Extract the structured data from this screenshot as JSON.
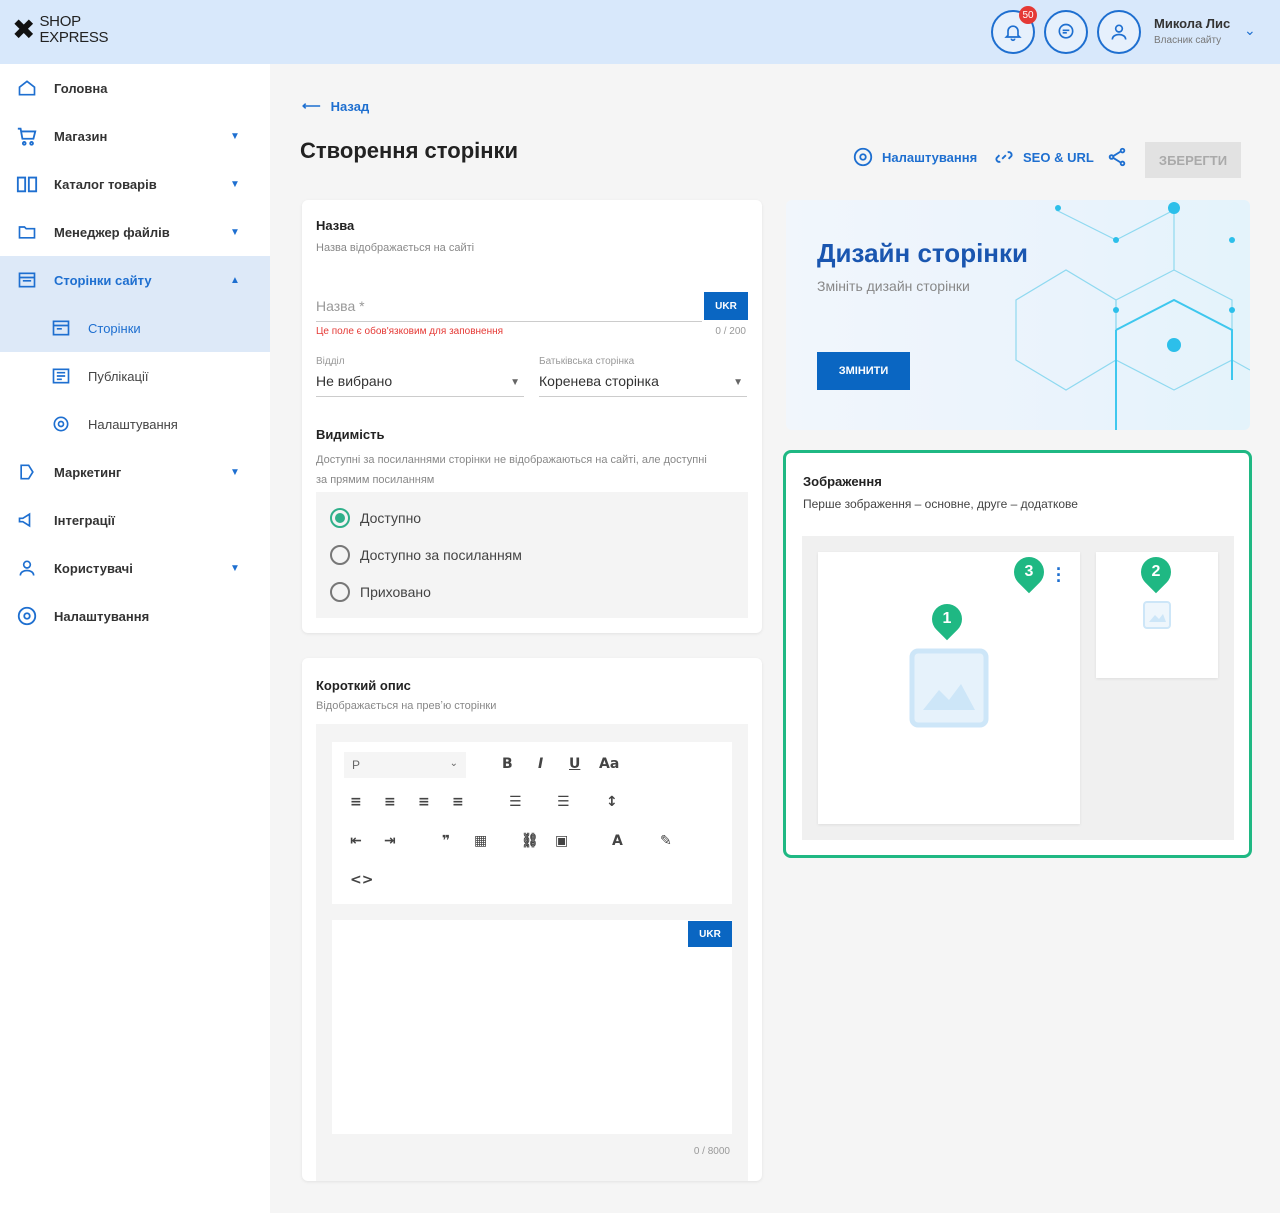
{
  "header": {
    "logo_top": "SHOP",
    "logo_bottom": "EXPRESS",
    "notifications_count": "50",
    "user_name": "Микола Лис",
    "user_role": "Власник сайту"
  },
  "sidebar": {
    "items": [
      {
        "label": "Головна"
      },
      {
        "label": "Магазин"
      },
      {
        "label": "Каталог товарів"
      },
      {
        "label": "Менеджер файлів"
      },
      {
        "label": "Сторінки сайту"
      },
      {
        "label": "Сторінки"
      },
      {
        "label": "Публікації"
      },
      {
        "label": "Налаштування"
      },
      {
        "label": "Маркетинг"
      },
      {
        "label": "Інтеграції"
      },
      {
        "label": "Користувачі"
      },
      {
        "label": "Налаштування"
      }
    ]
  },
  "page": {
    "back_label": "Назад",
    "title": "Створення сторінки",
    "settings_label": "Налаштування",
    "seo_label": "SEO & URL",
    "save_label": "ЗБЕРЕГТИ"
  },
  "name_card": {
    "title": "Назва",
    "subtitle": "Назва відображається на сайті",
    "name_placeholder": "Назва *",
    "lang_button": "UKR",
    "error": "Це поле є обов'язковим для заповнення",
    "counter": "0 / 200",
    "section_label": "Відділ",
    "section_value": "Не вибрано",
    "parent_label": "Батьківська сторінка",
    "parent_value": "Коренева сторінка",
    "visibility_title": "Видимість",
    "visibility_desc": "Доступні за посиланнями сторінки не відображаються на сайті, але доступні за прямим посиланням",
    "options": [
      "Доступно",
      "Доступно за посиланням",
      "Приховано"
    ]
  },
  "desc_card": {
    "title": "Короткий опис",
    "subtitle": "Відображається на превʼю сторінки",
    "format_value": "P",
    "lang_button": "UKR",
    "counter": "0 / 8000",
    "font_btn": "Aa"
  },
  "design": {
    "title": "Дизайн сторінки",
    "subtitle": "Змініть дизайн сторінки",
    "button": "ЗМІНИТИ"
  },
  "images": {
    "title": "Зображення",
    "subtitle": "Перше зображення – основне, друге – додаткове",
    "markers": [
      "1",
      "2",
      "3"
    ]
  },
  "colors": {
    "accent": "#1e6fd0",
    "primary_button": "#0a66c2",
    "highlight": "#1fb883"
  }
}
